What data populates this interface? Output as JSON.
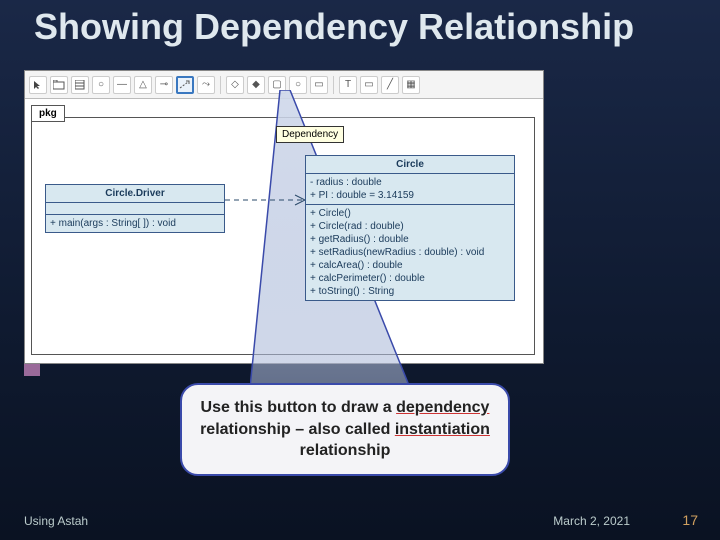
{
  "title": "Showing Dependency Relationship",
  "pkg_label": "pkg",
  "dependency_tooltip": "Dependency",
  "circle_driver": {
    "name": "Circle.Driver",
    "ops": [
      "+ main(args : String[ ]) : void"
    ]
  },
  "circle": {
    "name": "Circle",
    "attrs": [
      "- radius : double",
      "+ PI : double = 3.14159"
    ],
    "ops": [
      "+ Circle()",
      "+ Circle(rad : double)",
      "+ getRadius() : double",
      "+ setRadius(newRadius : double) : void",
      "+ calcArea() : double",
      "+ calcPerimeter() : double",
      "+ toString() : String"
    ]
  },
  "callout": {
    "prefix": "Use this button to draw a ",
    "word1": "dependency",
    "mid": " relationship – also called ",
    "word2": "instantiation",
    "suffix": " relationship"
  },
  "footer": {
    "tool": "Using Astah",
    "date": "March 2, 2021",
    "page": "17"
  }
}
